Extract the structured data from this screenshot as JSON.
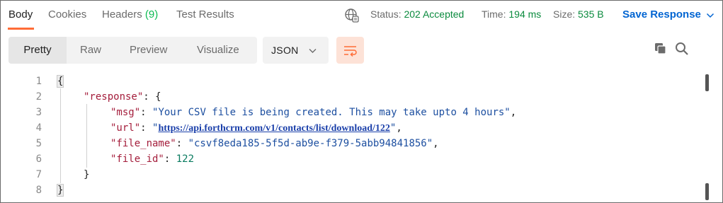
{
  "tabs": [
    {
      "label": "Body",
      "active": true
    },
    {
      "label": "Cookies"
    },
    {
      "label": "Headers",
      "count": "(9)"
    },
    {
      "label": "Test Results"
    }
  ],
  "status": {
    "status_label": "Status:",
    "status_value": "202 Accepted",
    "time_label": "Time:",
    "time_value": "194 ms",
    "size_label": "Size:",
    "size_value": "535 B"
  },
  "save_response_label": "Save Response",
  "modes": [
    "Pretty",
    "Raw",
    "Preview",
    "Visualize"
  ],
  "format": "JSON",
  "icons": {
    "network": "globe-icon",
    "wrap": "wrap-lines-icon",
    "copy": "copy-icon",
    "search": "search-icon"
  },
  "colors": {
    "accent": "#ff6c37",
    "status_green": "#0a8a3d",
    "link_blue": "#0265d2"
  },
  "editor": {
    "line_numbers": [
      "1",
      "2",
      "3",
      "4",
      "5",
      "6",
      "7",
      "8"
    ],
    "open_brace": "{",
    "response_key": "\"response\"",
    "response_open": ": {",
    "msg_key": "\"msg\"",
    "msg_value": "\"Your CSV file is being created. This may take upto 4 hours\"",
    "url_key": "\"url\"",
    "url_value": "https://api.forthcrm.com/v1/contacts/list/download/122",
    "file_name_key": "\"file_name\"",
    "file_name_value": "\"csvf8eda185-5f5d-ab9e-f379-5abb94841856\"",
    "file_id_key": "\"file_id\"",
    "file_id_value": "122",
    "inner_close": "}",
    "outer_close": "}"
  }
}
